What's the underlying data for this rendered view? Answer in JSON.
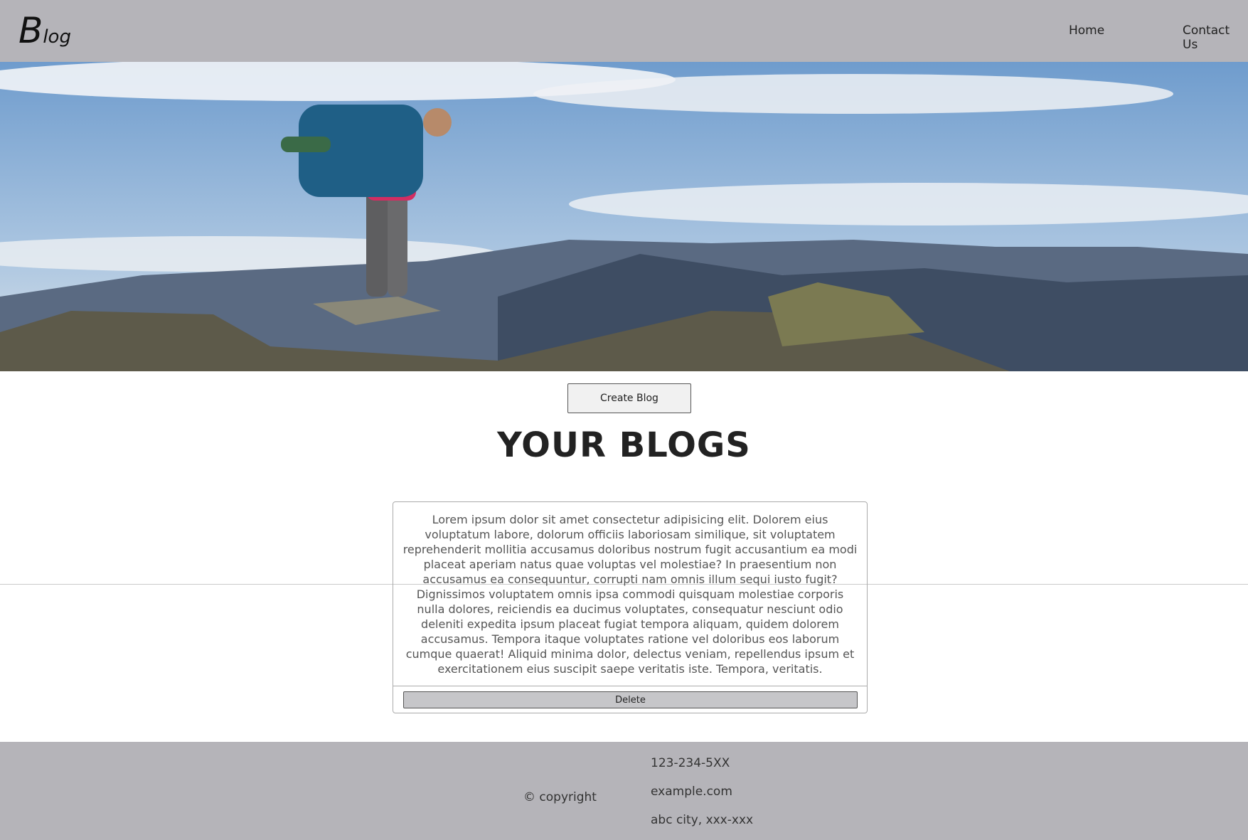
{
  "header": {
    "logo_big": "B",
    "logo_rest": "log",
    "nav": [
      "Home",
      "Contact Us"
    ]
  },
  "main": {
    "create_button": "Create Blog",
    "heading": "YOUR BLOGS",
    "blogs": [
      {
        "text": "Lorem ipsum dolor sit amet consectetur adipisicing elit. Dolorem eius voluptatum labore, dolorum officiis laboriosam similique, sit voluptatem reprehenderit mollitia accusamus doloribus nostrum fugit accusantium ea modi placeat aperiam natus quae voluptas vel molestiae? In praesentium non accusamus ea consequuntur, corrupti nam omnis illum sequi iusto fugit? Dignissimos voluptatem omnis ipsa commodi quisquam molestiae corporis nulla dolores, reiciendis ea ducimus voluptates, consequatur nesciunt odio deleniti expedita ipsum placeat fugiat tempora aliquam, quidem dolorem accusamus. Tempora itaque voluptates ratione vel doloribus eos laborum cumque quaerat! Aliquid minima dolor, delectus veniam, repellendus ipsum et exercitationem eius suscipit saepe veritatis iste. Tempora, veritatis.",
        "delete_label": "Delete"
      }
    ]
  },
  "footer": {
    "copyright": "© copyright",
    "phone": "123-234-5XX",
    "website": "example.com",
    "address": "abc city, xxx-xxx"
  },
  "colors": {
    "bar": "#b5b4b9"
  }
}
